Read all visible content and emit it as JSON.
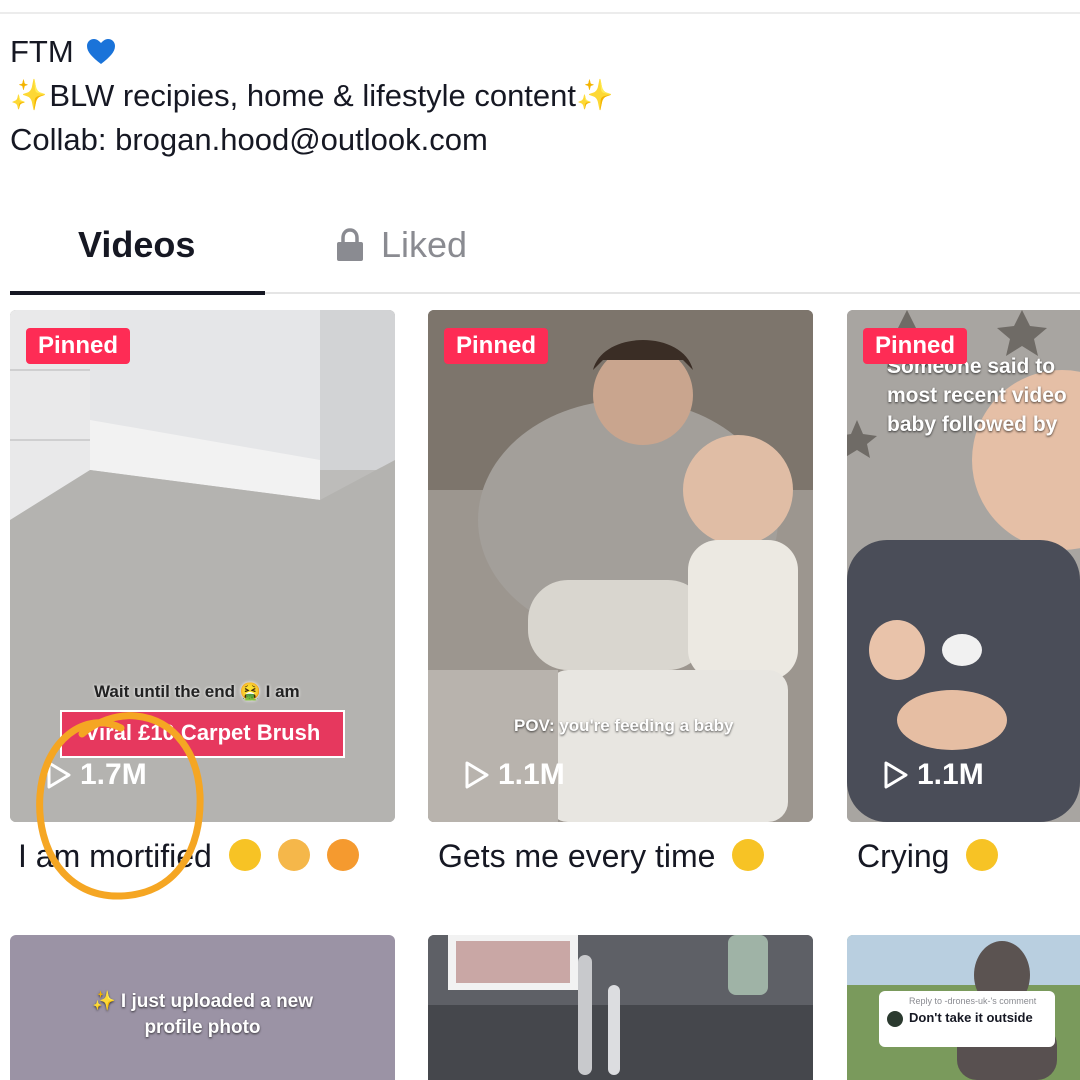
{
  "bio": {
    "name": "FTM",
    "line2": "BLW recipies, home & lifestyle content",
    "line3": "Collab: brogan.hood@outlook.com"
  },
  "tabs": {
    "videos": "Videos",
    "liked": "Liked"
  },
  "videos": [
    {
      "badge": "Pinned",
      "views": "1.7M",
      "caption": "I am mortified",
      "overlay_top": "Wait until the end 🤮 I am",
      "overlay_banner": "Viral £10 Carpet Brush"
    },
    {
      "badge": "Pinned",
      "views": "1.1M",
      "caption": "Gets me every time",
      "overlay": "POV: you're feeding a baby"
    },
    {
      "badge": "Pinned",
      "views": "1.1M",
      "caption": "Crying",
      "overlay": "Someone said to most recent video baby followed by"
    }
  ],
  "row2": [
    {
      "overlay": "✨ I just uploaded a new profile photo"
    },
    {
      "overlay": ""
    },
    {
      "reply_label": "Reply to -drones-uk-'s comment",
      "reply_text": "Don't take it outside"
    }
  ],
  "colors": {
    "accent": "#fe2c55",
    "annotation": "#f5a623"
  }
}
